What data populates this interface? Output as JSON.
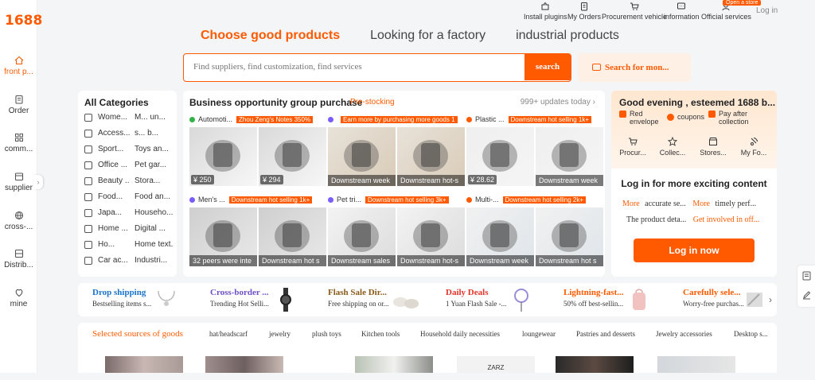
{
  "brand": {
    "logo": "1688",
    "accent": "#ff5a00"
  },
  "sidebar": {
    "items": [
      {
        "label": "front p...",
        "icon": "home-icon"
      },
      {
        "label": "Order",
        "icon": "order-icon"
      },
      {
        "label": "comm...",
        "icon": "grid-icon"
      },
      {
        "label": "supplier",
        "icon": "store-icon"
      },
      {
        "label": "cross-...",
        "icon": "globe-icon"
      },
      {
        "label": "Distrib...",
        "icon": "distribution-icon"
      },
      {
        "label": "mine",
        "icon": "user-icon"
      }
    ]
  },
  "topbar": {
    "items": [
      {
        "label": "Install plugins",
        "icon": "puzzle-icon"
      },
      {
        "label": "My Orders",
        "icon": "clipboard-icon"
      },
      {
        "label": "Procurement vehicle",
        "icon": "cart-icon"
      },
      {
        "label": "information",
        "icon": "message-icon"
      },
      {
        "label": "Official services",
        "icon": "headset-icon"
      }
    ],
    "open_store": "Open a store",
    "login": "Log in"
  },
  "tabs": [
    "Choose good products",
    "Looking for a factory",
    "industrial products"
  ],
  "search": {
    "placeholder": "Find suppliers, find customization, find services",
    "button": "search",
    "image_search": "Search for mon..."
  },
  "categories": {
    "title": "All Categories",
    "rows": [
      {
        "icon": "shirt-icon",
        "a": "Wome...",
        "b": "M... un..."
      },
      {
        "icon": "bag-icon",
        "a": "Access...",
        "b": "s... b..."
      },
      {
        "icon": "sport-icon",
        "a": "Sport...",
        "b": "Toys an..."
      },
      {
        "icon": "office-icon",
        "a": "Office ...",
        "b": "Pet gar..."
      },
      {
        "icon": "beauty-icon",
        "a": "Beauty ...",
        "b": "Stora..."
      },
      {
        "icon": "food-icon",
        "a": "Food...",
        "b": "Food an..."
      },
      {
        "icon": "home-goods-icon",
        "a": "Japa...",
        "b": "Househo..."
      },
      {
        "icon": "digital-icon",
        "a": "Home ...",
        "b": "Digital ..."
      },
      {
        "icon": "textile-icon",
        "a": "Ho...",
        "b": "Home text..."
      },
      {
        "icon": "car-icon",
        "a": "Car ac...",
        "b": "Industri..."
      }
    ]
  },
  "group_purchase": {
    "title": "Business opportunity group purchase",
    "subtitle": "Pre-stocking",
    "updates": "999+ updates today",
    "groups": [
      {
        "title": "Automoti...",
        "tag": "Zhou Zeng's Notes",
        "count": "350%",
        "dot": "#34b24a",
        "products": [
          {
            "price": "¥ 250",
            "overlay": ""
          },
          {
            "price": "¥ 294",
            "overlay": ""
          }
        ]
      },
      {
        "title": "",
        "tag": "Earn more by purchasing more goods",
        "count": "1",
        "dot": "#7a5cff",
        "products": [
          {
            "price": "",
            "overlay": "Downstream week"
          },
          {
            "price": "",
            "overlay": "Downstream hot-s"
          }
        ]
      },
      {
        "title": "Plastic ...",
        "tag": "Downstream hot selling",
        "count": "1k+",
        "dot": "#ff5a00",
        "products": [
          {
            "price": "¥ 28.62",
            "overlay": ""
          },
          {
            "price": "",
            "overlay": "Downstream week"
          }
        ]
      },
      {
        "title": "Men's ...",
        "tag": "Downstream hot selling",
        "count": "1k+",
        "dot": "#7a5cff",
        "products": [
          {
            "price": "",
            "overlay": "32 peers were inte"
          },
          {
            "price": "",
            "overlay": "Downstream hot s"
          }
        ]
      },
      {
        "title": "Pet tri...",
        "tag": "Downstream hot selling",
        "count": "3k+",
        "dot": "#7a5cff",
        "products": [
          {
            "price": "",
            "overlay": "Downstream sales"
          },
          {
            "price": "",
            "overlay": "Downstream hot-s"
          }
        ]
      },
      {
        "title": "Multi-...",
        "tag": "Downstream hot selling",
        "count": "2k+",
        "dot": "#ff5a00",
        "products": [
          {
            "price": "",
            "overlay": "Downstream week"
          },
          {
            "price": "",
            "overlay": "Downstream hot s"
          }
        ]
      }
    ]
  },
  "account": {
    "greeting": "Good evening , esteemed 1688 b...",
    "benefits": [
      {
        "label": "Red envelope"
      },
      {
        "label": "coupons"
      },
      {
        "label": "Pay after collection"
      }
    ],
    "quick": [
      {
        "label": "Procur...",
        "icon": "cart-icon"
      },
      {
        "label": "Collec...",
        "icon": "star-icon"
      },
      {
        "label": "Stores...",
        "icon": "store-icon"
      },
      {
        "label": "My Fo...",
        "icon": "footprint-icon"
      }
    ],
    "login_title": "Log in for more exciting content",
    "line1_a": "More",
    "line1_b": "accurate se...",
    "line1_c": "More",
    "line1_d": "timely perf...",
    "line2_a": "The product deta...",
    "line2_b": "Get involved in off...",
    "login_button": "Log in now"
  },
  "promos": [
    {
      "title": "Drop shipping",
      "sub": "Bestselling items s...",
      "color": "#1a73c9"
    },
    {
      "title": "Cross-border ...",
      "sub": "Trending Hot Selli...",
      "color": "#6b4fc7"
    },
    {
      "title": "Flash Sale Dir...",
      "sub": "Free shipping on or...",
      "color": "#8a5a1a"
    },
    {
      "title": "Daily Deals",
      "sub": "1 Yuan Flash Sale -...",
      "color": "#e0342a"
    },
    {
      "title": "Lightning-fast...",
      "sub": "50% off best-sellin...",
      "color": "#ff5a00"
    },
    {
      "title": "Carefully sele...",
      "sub": "Worry-free purchas...",
      "color": "#ff5a00"
    }
  ],
  "sources": {
    "title": "Selected sources of goods",
    "tabs": [
      "hat/headscarf",
      "jewelry",
      "plush toys",
      "Kitchen tools",
      "Household daily necessities",
      "loungewear",
      "Pastries and desserts",
      "Jewelry accessories",
      "Desktop s..."
    ]
  },
  "bottom_peek": "ZARZ"
}
